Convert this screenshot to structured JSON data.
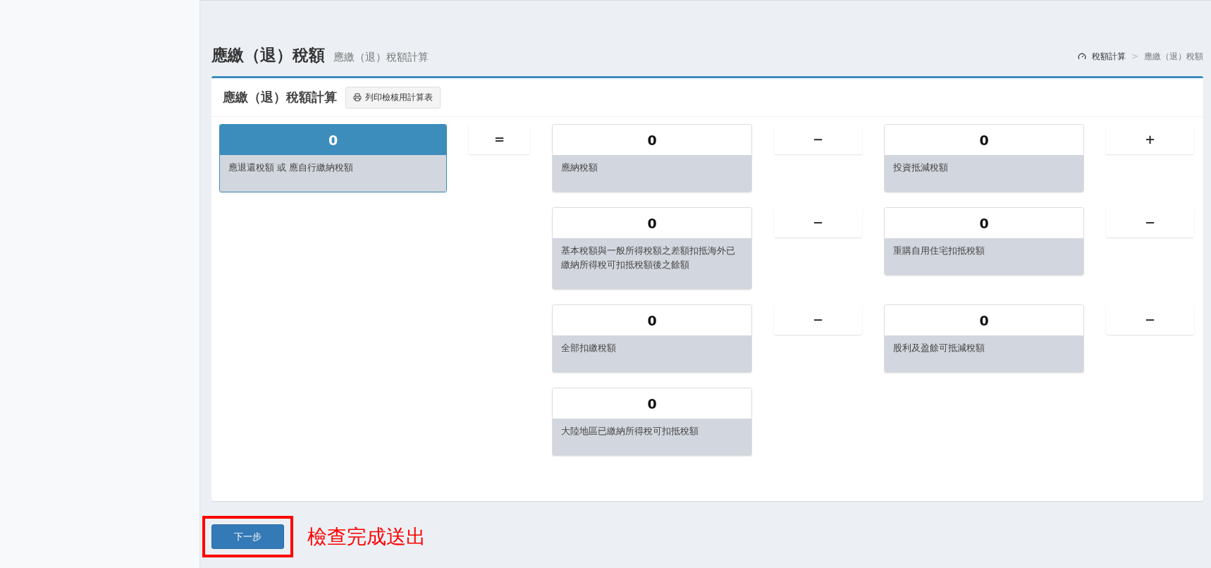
{
  "page_header": {
    "title": "應繳（退）稅額",
    "subtitle": "應繳（退）稅額計算"
  },
  "breadcrumb": [
    {
      "label": "稅額計算",
      "current": false
    },
    {
      "label": "應繳（退）稅額",
      "current": true
    }
  ],
  "breadcrumb_separator": ">",
  "card": {
    "title": "應繳（退）稅額計算",
    "print_button": "列印檢核用計算表"
  },
  "result": {
    "value": "0",
    "label": "應退還稅額 或 應自行繳納稅額",
    "operator": "="
  },
  "rows": [
    [
      {
        "value": "0",
        "label": "應納稅額",
        "operator": "−"
      },
      {
        "value": "0",
        "label": "投資抵減稅額",
        "operator": "+"
      }
    ],
    [
      {
        "value": "0",
        "label": "基本稅額與一般所得稅額之差額扣抵海外已繳納所得稅可扣抵稅額後之餘額",
        "operator": "−"
      },
      {
        "value": "0",
        "label": "重購自用住宅扣抵稅額",
        "operator": "−"
      }
    ],
    [
      {
        "value": "0",
        "label": "全部扣繳稅額",
        "operator": "−"
      },
      {
        "value": "0",
        "label": "股利及盈餘可抵減稅額",
        "operator": "−"
      }
    ],
    [
      {
        "value": "0",
        "label": "大陸地區已繳納所得稅可扣抵稅額"
      }
    ]
  ],
  "next_button": "下一步",
  "annotation": "檢查完成送出"
}
